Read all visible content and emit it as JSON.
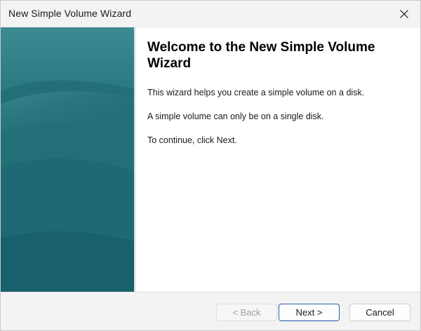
{
  "window": {
    "title": "New Simple Volume Wizard"
  },
  "icons": {
    "close": "close-icon"
  },
  "colors": {
    "banner": "#25717a",
    "default_button_border": "#2a5fb0"
  },
  "main": {
    "heading": "Welcome to the New Simple Volume Wizard",
    "paragraphs": [
      "This wizard helps you create a simple volume on a disk.",
      "A simple volume can only be on a single disk.",
      "To continue, click Next."
    ]
  },
  "footer": {
    "back_label": "< Back",
    "next_label": "Next >",
    "cancel_label": "Cancel"
  }
}
